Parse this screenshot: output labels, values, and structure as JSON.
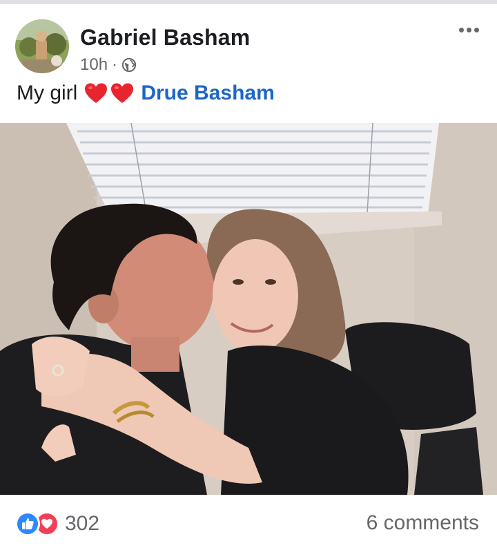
{
  "post": {
    "author": "Gabriel Basham",
    "time": "10h",
    "separator": "·",
    "audience_icon": "globe-icon",
    "caption_text": "My girl",
    "caption_emoji": [
      "red-heart",
      "red-heart"
    ],
    "mention": "Drue Basham",
    "image_subject": "couple-selfie-photo"
  },
  "footer": {
    "reaction_icons": [
      "like-icon",
      "love-icon"
    ],
    "reaction_count": "302",
    "comments": "6 comments"
  },
  "colors": {
    "link_blue": "#1b66c9",
    "meta_gray": "#65676b",
    "like_blue": "#2d88ff",
    "love_red": "#f33e58",
    "heart_red": "#e8242f"
  }
}
